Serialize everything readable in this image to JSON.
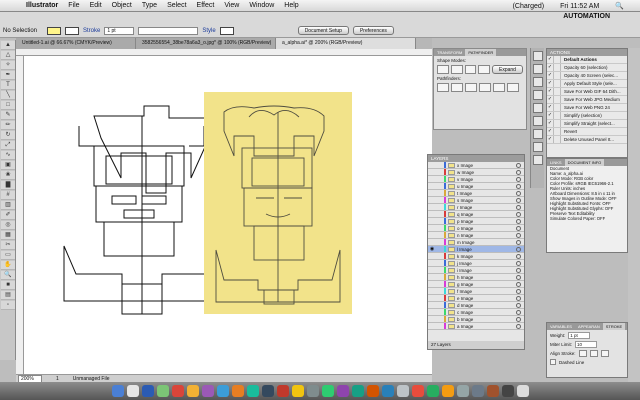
{
  "menubar": {
    "apple": "",
    "app": "Illustrator",
    "items": [
      "File",
      "Edit",
      "Object",
      "Type",
      "Select",
      "Effect",
      "View",
      "Window",
      "Help"
    ],
    "battery": "(Charged)",
    "clock": "Fri 11:52 AM"
  },
  "control_bar": {
    "workspace": "AUTOMATION",
    "selection": "No Selection",
    "stroke_label": "Stroke",
    "stroke_value": "1 pt",
    "style_label": "Style",
    "document_setup": "Document Setup",
    "preferences": "Preferences"
  },
  "tabs": [
    "Untitled-1.ai @ 66.67% (CMYK/Preview)",
    "3582556554_38be78a6a3_o.jpg* @ 100% (RGB/Preview)",
    "a_alpha.ai* @ 200% (RGB/Preview)"
  ],
  "window_title": "a_alpha.ai* @ 200% (RGB/Preview)",
  "status": {
    "zoom": "200%",
    "page": "1",
    "mode": "Unmanaged File"
  },
  "pathfinder": {
    "tab_transform": "TRANSFORM",
    "tab_pathfinder": "PATHFINDER",
    "shape_modes": "Shape Modes:",
    "pathfinders": "Pathfinders:",
    "expand": "Expand"
  },
  "layers": {
    "title": "LAYERS",
    "rows": [
      {
        "name": "x Image",
        "color": "#3b6bd8"
      },
      {
        "name": "w Image",
        "color": "#d83b3b"
      },
      {
        "name": "v Image",
        "color": "#3bd86b"
      },
      {
        "name": "u Image",
        "color": "#3b6bd8"
      },
      {
        "name": "t Image",
        "color": "#d8a83b"
      },
      {
        "name": "s Image",
        "color": "#d83bd8"
      },
      {
        "name": "r Image",
        "color": "#3bd8d8"
      },
      {
        "name": "q Image",
        "color": "#d83b3b"
      },
      {
        "name": "p Image",
        "color": "#3b6bd8"
      },
      {
        "name": "o Image",
        "color": "#3bd86b"
      },
      {
        "name": "n Image",
        "color": "#d8a83b"
      },
      {
        "name": "m Image",
        "color": "#d83bd8"
      },
      {
        "name": "l Image",
        "color": "#3bd8d8"
      },
      {
        "name": "k Image",
        "color": "#d83b3b"
      },
      {
        "name": "j Image",
        "color": "#3b6bd8"
      },
      {
        "name": "i Image",
        "color": "#3bd86b"
      },
      {
        "name": "h Image",
        "color": "#d8a83b"
      },
      {
        "name": "g Image",
        "color": "#d83bd8"
      },
      {
        "name": "f Image",
        "color": "#3bd8d8"
      },
      {
        "name": "e Image",
        "color": "#d83b3b"
      },
      {
        "name": "d Image",
        "color": "#3b6bd8"
      },
      {
        "name": "c Image",
        "color": "#3bd86b"
      },
      {
        "name": "b Image",
        "color": "#d8a83b"
      },
      {
        "name": "a Image",
        "color": "#d83bd8"
      }
    ],
    "footer": "27 Layers"
  },
  "actions": {
    "title": "ACTIONS",
    "items": [
      "Default Actions",
      "Opacity 60 (selection)",
      "Opacity 40 Screen (selec...",
      "Apply Default Style (sele...",
      "Save For Web GIF 64 Dith...",
      "Save For Web JPG Medium",
      "Save For Web PNG 24",
      "Simplify (selection)",
      "Simplify Straight (select...",
      "Revert",
      "Delete Unused Panel It..."
    ]
  },
  "docinfo": {
    "tab_links": "LINKS",
    "tab_docinfo": "DOCUMENT INFO",
    "lines": [
      "Document",
      "Name: a_alpha.ai",
      "Color Mode: RGB color",
      "Color Profile: sRGB IEC61966-2.1",
      "Ruler Units: inches",
      "Artboard Dimensions: 8.5 in x 11 in",
      "Show Images in Outline Mode: OFF",
      "Highlight Substituted Fonts: OFF",
      "Highlight Substituted Glyphs: OFF",
      "Preserve Text Editability",
      "Simulate Colored Paper: OFF"
    ]
  },
  "stroke": {
    "tab_variables": "VARIABLES",
    "tab_appearance": "APPEARAN",
    "tab_stroke": "STROKE",
    "weight_label": "Weight:",
    "weight_value": "1 pt",
    "miter_label": "Miter Limit:",
    "miter_value": "10",
    "align_label": "Align Stroke:",
    "dashed_label": "Dashed Line"
  },
  "dock_colors": [
    "#4a7fd4",
    "#e6e6e6",
    "#2b5bb3",
    "#7cc576",
    "#d9453a",
    "#f2b134",
    "#9b59b6",
    "#3b9dd8",
    "#e67e22",
    "#1abc9c",
    "#34495e",
    "#c0392b",
    "#f1c40f",
    "#7f8c8d",
    "#2ecc71",
    "#8e44ad",
    "#16a085",
    "#d35400",
    "#2980b9",
    "#bdc3c7",
    "#e74c3c",
    "#27ae60",
    "#f39c12",
    "#95a5a6",
    "#6c7a89",
    "#a0522d",
    "#444444",
    "#dcdcdc"
  ]
}
